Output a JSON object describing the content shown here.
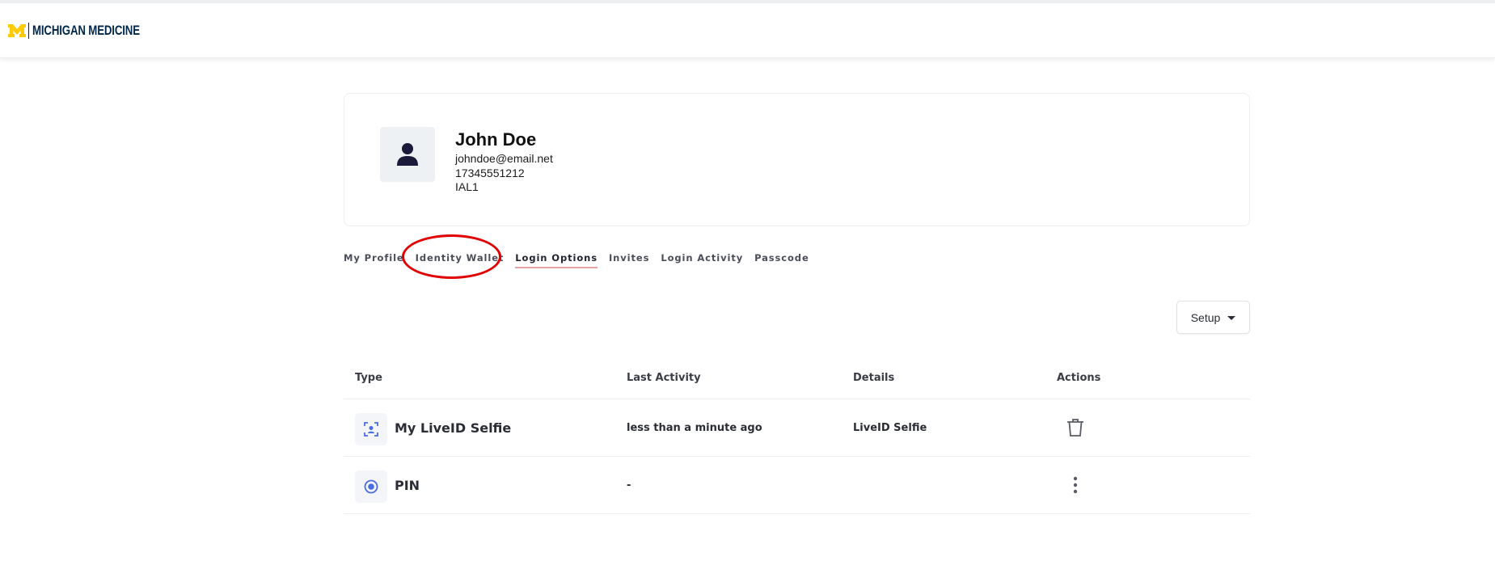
{
  "brand": {
    "wordmark": "MICHIGAN MEDICINE",
    "color": "#00274c",
    "accent": "#ffcb05"
  },
  "profile": {
    "name": "John Doe",
    "email": "johndoe@email.net",
    "phone": "17345551212",
    "level": "IAL1"
  },
  "tabs": [
    {
      "label": "My Profile",
      "active": false
    },
    {
      "label": "Identity Wallet",
      "active": false
    },
    {
      "label": "Login Options",
      "active": true
    },
    {
      "label": "Invites",
      "active": false
    },
    {
      "label": "Login Activity",
      "active": false
    },
    {
      "label": "Passcode",
      "active": false
    }
  ],
  "setup": {
    "label": "Setup"
  },
  "table": {
    "headers": {
      "type": "Type",
      "last_activity": "Last Activity",
      "details": "Details",
      "actions": "Actions"
    },
    "rows": [
      {
        "type": "My LiveID Selfie",
        "icon": "face-scan-icon",
        "last_activity": "less than a minute ago",
        "details": "LiveID Selfie",
        "action_icon": "trash-icon"
      },
      {
        "type": "PIN",
        "icon": "radio-pin-icon",
        "last_activity": "-",
        "details": "",
        "action_icon": "kebab-menu-icon"
      }
    ]
  },
  "colors": {
    "annotation": "#e00000",
    "active_tab_underline": "#e8a3a3",
    "icon_blue": "#4a6ee0"
  }
}
